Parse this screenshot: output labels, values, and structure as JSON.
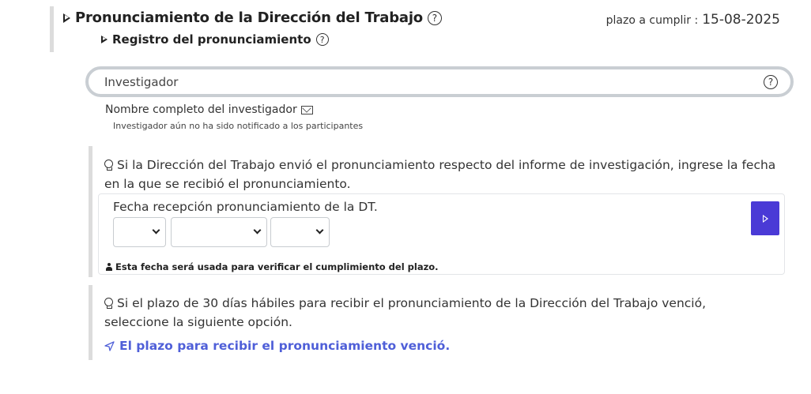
{
  "header": {
    "title": "Pronunciamiento de la Dirección del Trabajo",
    "deadline_label": "plazo a cumplir :",
    "deadline_value": "15-08-2025",
    "subtitle": "Registro del pronunciamiento"
  },
  "investigator": {
    "placeholder": "Investigador",
    "name_label": "Nombre completo del investigador",
    "notice": "Investigador aún no ha sido notificado a los participantes"
  },
  "reception": {
    "tip": "Si la Dirección del Trabajo envió el pronunciamiento respecto del informe de investigación, ingrese la fecha en la que se recibió el pronunciamiento.",
    "date_label": "Fecha recepción pronunciamiento de la DT.",
    "day_value": "",
    "month_value": "",
    "year_value": "",
    "note": "Esta fecha será usada para verificar el cumplimiento del plazo."
  },
  "expired": {
    "tip": "Si el plazo de 30 días hábiles para recibir el pronunciamiento de la Dirección del Trabajo venció, seleccione la siguiente opción.",
    "link_label": "El plazo para recibir el pronunciamiento venció."
  },
  "icons": {
    "help": "question-circle-icon",
    "expand": "caret-right-icon",
    "mail": "envelope-icon",
    "tip": "lightbulb-icon",
    "submit": "play-icon",
    "link": "send-icon"
  },
  "colors": {
    "accent": "#4a3ad6",
    "link": "#4f5fd8",
    "border": "#c9ced3"
  }
}
